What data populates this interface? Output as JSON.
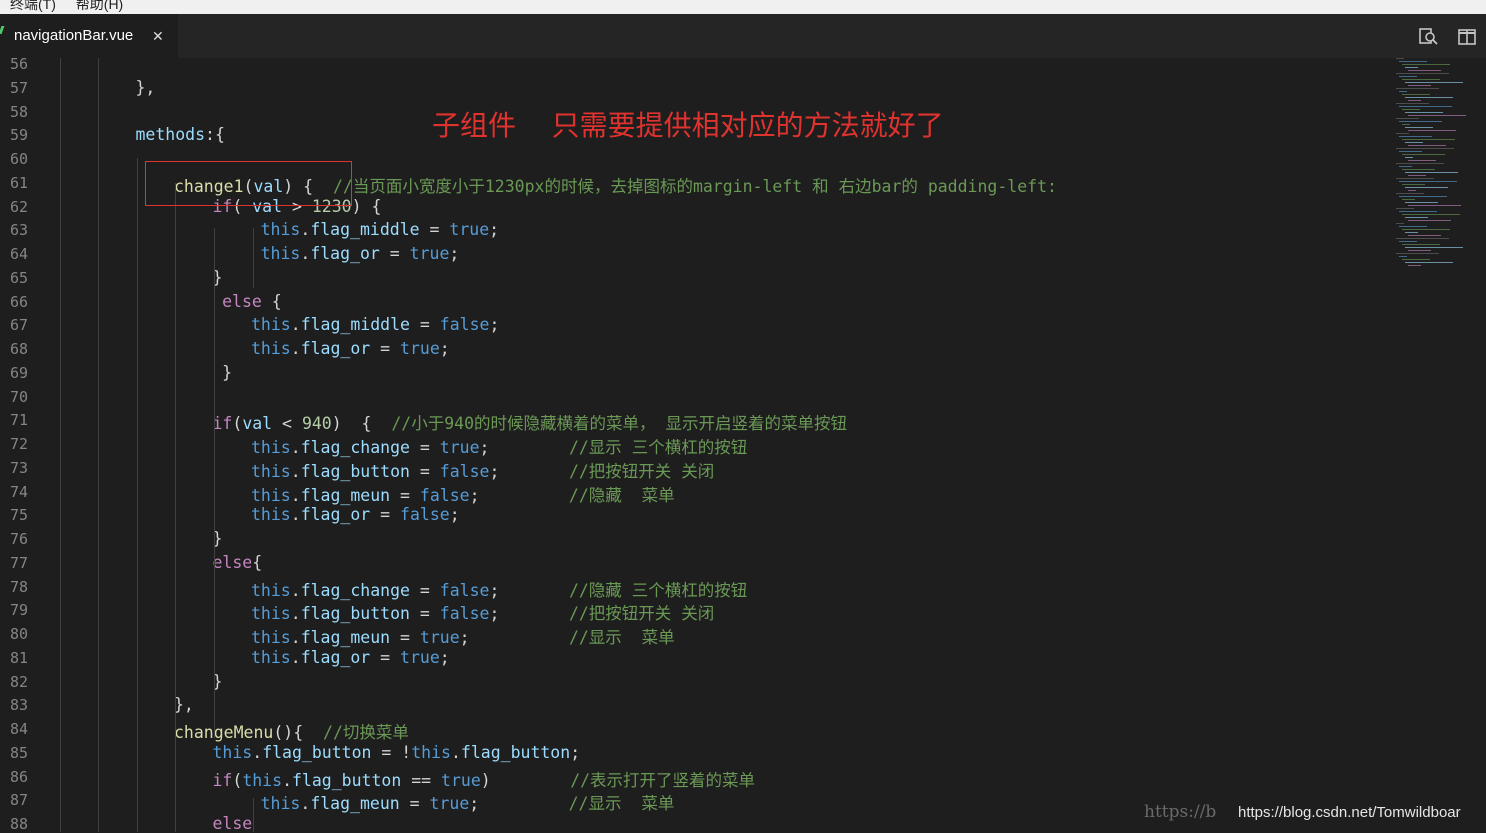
{
  "menu": {
    "item1": "终端(T)",
    "item2": "帮助(H)"
  },
  "tab": {
    "filename": "navigationBar.vue",
    "close": "✕"
  },
  "toolbar": {
    "icon1": "search-compare-icon",
    "icon2": "split-editor-icon"
  },
  "annotation": "子组件    只需要提供相对应的方法就好了",
  "watermark": {
    "text": "https://blog.csdn.net/Tomwildboar",
    "ghost": "https://b"
  },
  "colors": {
    "keyword": "#569cd6",
    "comment": "#6a9955",
    "function": "#dcdcaa",
    "control": "#c586c0",
    "annotation": "#e0322e",
    "background": "#1e1e1e"
  },
  "lines": [
    {
      "n": "56",
      "indent": 0,
      "tokens": []
    },
    {
      "n": "57",
      "indent": 3,
      "tokens": [
        {
          "t": "},",
          "c": "w"
        }
      ]
    },
    {
      "n": "58",
      "indent": 0,
      "tokens": []
    },
    {
      "n": "59",
      "indent": 3,
      "tokens": [
        {
          "t": "methods",
          "c": "p"
        },
        {
          "t": ":{",
          "c": "w"
        }
      ]
    },
    {
      "n": "60",
      "indent": 0,
      "tokens": []
    },
    {
      "n": "61",
      "indent": 4,
      "tokens": [
        {
          "t": "change1",
          "c": "f"
        },
        {
          "t": "(",
          "c": "w"
        },
        {
          "t": "val",
          "c": "p"
        },
        {
          "t": ") {  ",
          "c": "w"
        },
        {
          "t": "//当页面小宽度小于1230px的时候，去掉图标的margin-left 和 右边bar的 padding-left:",
          "c": "c"
        }
      ]
    },
    {
      "n": "62",
      "indent": 5,
      "tokens": [
        {
          "t": "if",
          "c": "cp"
        },
        {
          "t": "( ",
          "c": "w"
        },
        {
          "t": "val",
          "c": "p"
        },
        {
          "t": " > ",
          "c": "w"
        },
        {
          "t": "1230",
          "c": "n"
        },
        {
          "t": ") {",
          "c": "w"
        }
      ]
    },
    {
      "n": "63",
      "indent": 6.25,
      "tokens": [
        {
          "t": "this",
          "c": "k"
        },
        {
          "t": ".",
          "c": "w"
        },
        {
          "t": "flag_middle",
          "c": "p"
        },
        {
          "t": " = ",
          "c": "w"
        },
        {
          "t": "true",
          "c": "k"
        },
        {
          "t": ";",
          "c": "w"
        }
      ]
    },
    {
      "n": "64",
      "indent": 6.25,
      "tokens": [
        {
          "t": "this",
          "c": "k"
        },
        {
          "t": ".",
          "c": "w"
        },
        {
          "t": "flag_or",
          "c": "p"
        },
        {
          "t": " = ",
          "c": "w"
        },
        {
          "t": "true",
          "c": "k"
        },
        {
          "t": ";",
          "c": "w"
        }
      ]
    },
    {
      "n": "65",
      "indent": 5,
      "tokens": [
        {
          "t": "}",
          "c": "w"
        }
      ]
    },
    {
      "n": "66",
      "indent": 5.25,
      "tokens": [
        {
          "t": "else",
          "c": "cp"
        },
        {
          "t": " {",
          "c": "w"
        }
      ]
    },
    {
      "n": "67",
      "indent": 6,
      "tokens": [
        {
          "t": "this",
          "c": "k"
        },
        {
          "t": ".",
          "c": "w"
        },
        {
          "t": "flag_middle",
          "c": "p"
        },
        {
          "t": " = ",
          "c": "w"
        },
        {
          "t": "false",
          "c": "k"
        },
        {
          "t": ";",
          "c": "w"
        }
      ]
    },
    {
      "n": "68",
      "indent": 6,
      "tokens": [
        {
          "t": "this",
          "c": "k"
        },
        {
          "t": ".",
          "c": "w"
        },
        {
          "t": "flag_or",
          "c": "p"
        },
        {
          "t": " = ",
          "c": "w"
        },
        {
          "t": "true",
          "c": "k"
        },
        {
          "t": ";",
          "c": "w"
        }
      ]
    },
    {
      "n": "69",
      "indent": 5.25,
      "tokens": [
        {
          "t": "}",
          "c": "w"
        }
      ]
    },
    {
      "n": "70",
      "indent": 0,
      "tokens": []
    },
    {
      "n": "71",
      "indent": 5,
      "tokens": [
        {
          "t": "if",
          "c": "cp"
        },
        {
          "t": "(",
          "c": "w"
        },
        {
          "t": "val",
          "c": "p"
        },
        {
          "t": " < ",
          "c": "w"
        },
        {
          "t": "940",
          "c": "n"
        },
        {
          "t": ")  {  ",
          "c": "w"
        },
        {
          "t": "//小于940的时候隐藏横着的菜单， 显示开启竖着的菜单按钮",
          "c": "c"
        }
      ]
    },
    {
      "n": "72",
      "indent": 6,
      "tokens": [
        {
          "t": "this",
          "c": "k"
        },
        {
          "t": ".",
          "c": "w"
        },
        {
          "t": "flag_change",
          "c": "p"
        },
        {
          "t": " = ",
          "c": "w"
        },
        {
          "t": "true",
          "c": "k"
        },
        {
          "t": ";        ",
          "c": "w"
        },
        {
          "t": "//显示 三个横杠的按钮",
          "c": "c"
        }
      ]
    },
    {
      "n": "73",
      "indent": 6,
      "tokens": [
        {
          "t": "this",
          "c": "k"
        },
        {
          "t": ".",
          "c": "w"
        },
        {
          "t": "flag_button",
          "c": "p"
        },
        {
          "t": " = ",
          "c": "w"
        },
        {
          "t": "false",
          "c": "k"
        },
        {
          "t": ";       ",
          "c": "w"
        },
        {
          "t": "//把按钮开关 关闭",
          "c": "c"
        }
      ]
    },
    {
      "n": "74",
      "indent": 6,
      "tokens": [
        {
          "t": "this",
          "c": "k"
        },
        {
          "t": ".",
          "c": "w"
        },
        {
          "t": "flag_meun",
          "c": "p"
        },
        {
          "t": " = ",
          "c": "w"
        },
        {
          "t": "false",
          "c": "k"
        },
        {
          "t": ";         ",
          "c": "w"
        },
        {
          "t": "//隐藏  菜单",
          "c": "c"
        }
      ]
    },
    {
      "n": "75",
      "indent": 6,
      "tokens": [
        {
          "t": "this",
          "c": "k"
        },
        {
          "t": ".",
          "c": "w"
        },
        {
          "t": "flag_or",
          "c": "p"
        },
        {
          "t": " = ",
          "c": "w"
        },
        {
          "t": "false",
          "c": "k"
        },
        {
          "t": ";",
          "c": "w"
        }
      ]
    },
    {
      "n": "76",
      "indent": 5,
      "tokens": [
        {
          "t": "}",
          "c": "w"
        }
      ]
    },
    {
      "n": "77",
      "indent": 5,
      "tokens": [
        {
          "t": "else",
          "c": "cp"
        },
        {
          "t": "{",
          "c": "w"
        }
      ]
    },
    {
      "n": "78",
      "indent": 6,
      "tokens": [
        {
          "t": "this",
          "c": "k"
        },
        {
          "t": ".",
          "c": "w"
        },
        {
          "t": "flag_change",
          "c": "p"
        },
        {
          "t": " = ",
          "c": "w"
        },
        {
          "t": "false",
          "c": "k"
        },
        {
          "t": ";       ",
          "c": "w"
        },
        {
          "t": "//隐藏 三个横杠的按钮",
          "c": "c"
        }
      ]
    },
    {
      "n": "79",
      "indent": 6,
      "tokens": [
        {
          "t": "this",
          "c": "k"
        },
        {
          "t": ".",
          "c": "w"
        },
        {
          "t": "flag_button",
          "c": "p"
        },
        {
          "t": " = ",
          "c": "w"
        },
        {
          "t": "false",
          "c": "k"
        },
        {
          "t": ";       ",
          "c": "w"
        },
        {
          "t": "//把按钮开关 关闭",
          "c": "c"
        }
      ]
    },
    {
      "n": "80",
      "indent": 6,
      "tokens": [
        {
          "t": "this",
          "c": "k"
        },
        {
          "t": ".",
          "c": "w"
        },
        {
          "t": "flag_meun",
          "c": "p"
        },
        {
          "t": " = ",
          "c": "w"
        },
        {
          "t": "true",
          "c": "k"
        },
        {
          "t": ";          ",
          "c": "w"
        },
        {
          "t": "//显示  菜单",
          "c": "c"
        }
      ]
    },
    {
      "n": "81",
      "indent": 6,
      "tokens": [
        {
          "t": "this",
          "c": "k"
        },
        {
          "t": ".",
          "c": "w"
        },
        {
          "t": "flag_or",
          "c": "p"
        },
        {
          "t": " = ",
          "c": "w"
        },
        {
          "t": "true",
          "c": "k"
        },
        {
          "t": ";",
          "c": "w"
        }
      ]
    },
    {
      "n": "82",
      "indent": 5,
      "tokens": [
        {
          "t": "}",
          "c": "w"
        }
      ]
    },
    {
      "n": "83",
      "indent": 4,
      "tokens": [
        {
          "t": "},",
          "c": "w"
        }
      ]
    },
    {
      "n": "84",
      "indent": 4,
      "tokens": [
        {
          "t": "changeMenu",
          "c": "f"
        },
        {
          "t": "(){  ",
          "c": "w"
        },
        {
          "t": "//切换菜单",
          "c": "c"
        }
      ]
    },
    {
      "n": "85",
      "indent": 5,
      "tokens": [
        {
          "t": "this",
          "c": "k"
        },
        {
          "t": ".",
          "c": "w"
        },
        {
          "t": "flag_button",
          "c": "p"
        },
        {
          "t": " = !",
          "c": "w"
        },
        {
          "t": "this",
          "c": "k"
        },
        {
          "t": ".",
          "c": "w"
        },
        {
          "t": "flag_button",
          "c": "p"
        },
        {
          "t": ";",
          "c": "w"
        }
      ]
    },
    {
      "n": "86",
      "indent": 5,
      "tokens": [
        {
          "t": "if",
          "c": "cp"
        },
        {
          "t": "(",
          "c": "w"
        },
        {
          "t": "this",
          "c": "k"
        },
        {
          "t": ".",
          "c": "w"
        },
        {
          "t": "flag_button",
          "c": "p"
        },
        {
          "t": " == ",
          "c": "w"
        },
        {
          "t": "true",
          "c": "k"
        },
        {
          "t": ")        ",
          "c": "w"
        },
        {
          "t": "//表示打开了竖着的菜单",
          "c": "c"
        }
      ]
    },
    {
      "n": "87",
      "indent": 6.25,
      "tokens": [
        {
          "t": "this",
          "c": "k"
        },
        {
          "t": ".",
          "c": "w"
        },
        {
          "t": "flag_meun",
          "c": "p"
        },
        {
          "t": " = ",
          "c": "w"
        },
        {
          "t": "true",
          "c": "k"
        },
        {
          "t": ";         ",
          "c": "w"
        },
        {
          "t": "//显示  菜单",
          "c": "c"
        }
      ]
    },
    {
      "n": "88",
      "indent": 5,
      "tokens": [
        {
          "t": "else",
          "c": "cp"
        }
      ]
    }
  ]
}
